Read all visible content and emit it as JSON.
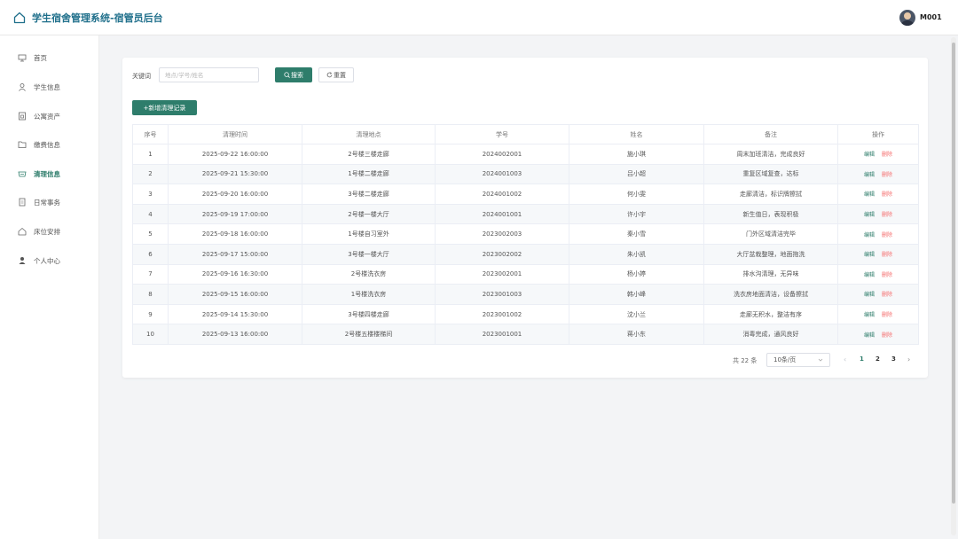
{
  "header": {
    "title": "学生宿舍管理系统-宿管员后台",
    "user": "M001"
  },
  "sidebar": {
    "items": [
      {
        "label": "首页",
        "icon": "home-desk-icon"
      },
      {
        "label": "学生信息",
        "icon": "user-icon"
      },
      {
        "label": "公寓资产",
        "icon": "asset-icon"
      },
      {
        "label": "缴费信息",
        "icon": "folder-icon"
      },
      {
        "label": "清理信息",
        "icon": "clean-icon",
        "active": true
      },
      {
        "label": "日常事务",
        "icon": "document-icon"
      },
      {
        "label": "床位安排",
        "icon": "house-icon"
      },
      {
        "label": "个人中心",
        "icon": "person-icon"
      }
    ]
  },
  "search": {
    "label": "关键词",
    "placeholder": "地点/学号/姓名",
    "search_button": "搜索",
    "reset_button": "重置"
  },
  "toolbar": {
    "add_button": "+新增清理记录"
  },
  "table": {
    "columns": [
      "序号",
      "清理时间",
      "清理地点",
      "学号",
      "姓名",
      "备注",
      "操作"
    ],
    "rows": [
      [
        "1",
        "2025-09-22 16:00:00",
        "2号楼三楼走廊",
        "2024002001",
        "施小琪",
        "周末加班清洁，完成良好"
      ],
      [
        "2",
        "2025-09-21 15:30:00",
        "1号楼二楼走廊",
        "2024001003",
        "吕小超",
        "重复区域复查，达标"
      ],
      [
        "3",
        "2025-09-20 16:00:00",
        "3号楼二楼走廊",
        "2024001002",
        "何小雯",
        "走廊清洁，标识牌擦拭"
      ],
      [
        "4",
        "2025-09-19 17:00:00",
        "2号楼一楼大厅",
        "2024001001",
        "许小宇",
        "新生值日，表现积极"
      ],
      [
        "5",
        "2025-09-18 16:00:00",
        "1号楼自习室外",
        "2023002003",
        "秦小雪",
        "门外区域清洁完毕"
      ],
      [
        "6",
        "2025-09-17 15:00:00",
        "3号楼一楼大厅",
        "2023002002",
        "朱小凯",
        "大厅盆栽整理，地面拖洗"
      ],
      [
        "7",
        "2025-09-16 16:30:00",
        "2号楼洗衣房",
        "2023002001",
        "杨小婷",
        "排水沟清理，无异味"
      ],
      [
        "8",
        "2025-09-15 16:00:00",
        "1号楼洗衣房",
        "2023001003",
        "韩小峰",
        "洗衣房地面清洁，设备擦拭"
      ],
      [
        "9",
        "2025-09-14 15:30:00",
        "3号楼四楼走廊",
        "2023001002",
        "沈小兰",
        "走廊无积水，整洁有序"
      ],
      [
        "10",
        "2025-09-13 16:00:00",
        "2号楼五楼楼梯间",
        "2023001001",
        "蒋小东",
        "消毒完成，通风良好"
      ]
    ],
    "actions": {
      "edit": "编辑",
      "delete": "删除"
    }
  },
  "pagination": {
    "total": "共 22 条",
    "page_size": "10条/页",
    "pages": [
      "1",
      "2",
      "3"
    ],
    "current": "1"
  },
  "colors": {
    "primary": "#2e7d6b",
    "danger": "#f56c6c",
    "title": "#1f6f8b"
  }
}
